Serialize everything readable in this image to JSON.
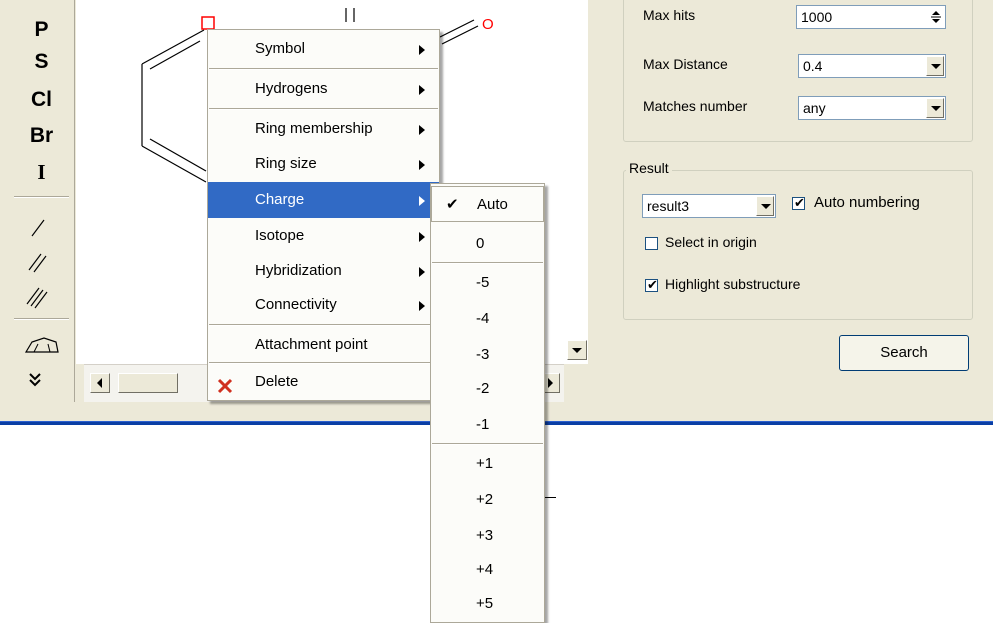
{
  "toolbar": {
    "elements": [
      "P",
      "S",
      "Cl",
      "Br",
      "I"
    ]
  },
  "canvas": {
    "atom_label": "O"
  },
  "search_options": {
    "max_hits_label": "Max hits",
    "max_hits_value": "1000",
    "max_distance_label": "Max Distance",
    "max_distance_value": "0.4",
    "matches_number_label": "Matches number",
    "matches_number_value": "any"
  },
  "result_group": {
    "legend": "Result",
    "result_value": "result3",
    "auto_numbering_label": "Auto numbering",
    "auto_numbering_checked": true,
    "select_in_origin_label": "Select in origin",
    "select_in_origin_checked": false,
    "highlight_label": "Highlight substructure",
    "highlight_checked": true
  },
  "search_button_label": "Search",
  "context_menu": {
    "items": [
      "Symbol",
      "Hydrogens",
      "Ring membership",
      "Ring size",
      "Charge",
      "Isotope",
      "Hybridization",
      "Connectivity",
      "Attachment point",
      "Delete"
    ],
    "active_item": "Charge"
  },
  "charge_submenu": {
    "checked_item": "Auto",
    "items": [
      "Auto",
      "0",
      "-5",
      "-4",
      "-3",
      "-2",
      "-1",
      "+1",
      "+2",
      "+3",
      "+4",
      "+5"
    ]
  },
  "colors": {
    "highlight": "#316ac5",
    "window_bg": "#ece9d8",
    "divider_blue": "#0a3ea4",
    "atom_red": "#ff0000",
    "delete_icon": "#d03020"
  }
}
